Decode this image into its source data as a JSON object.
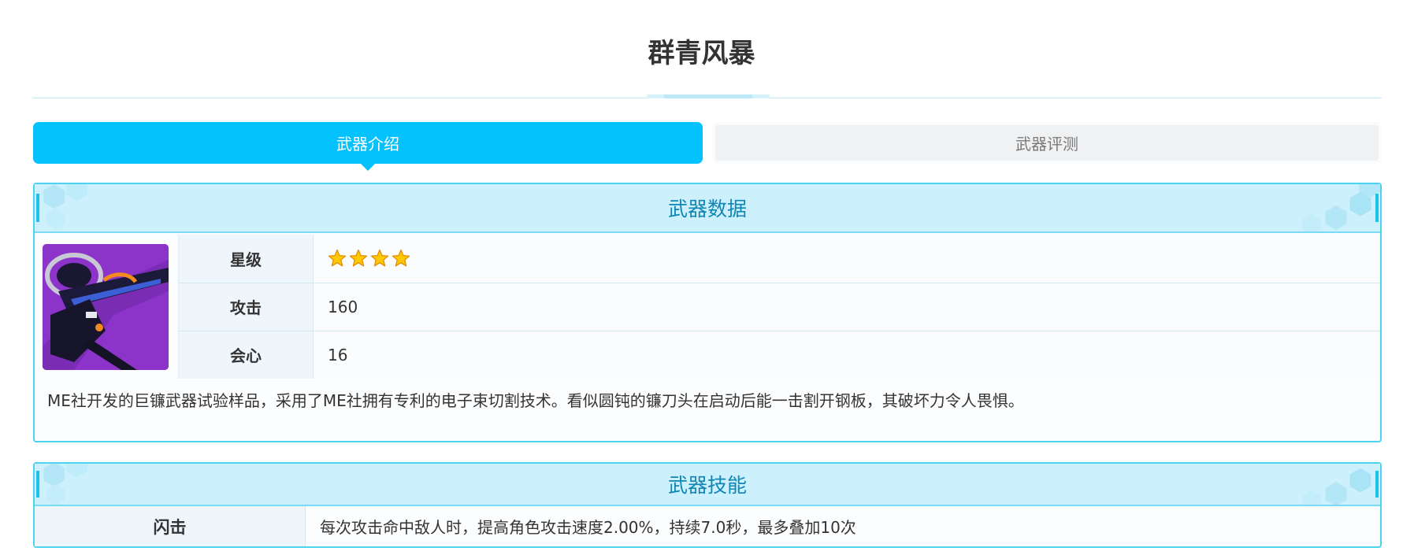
{
  "page": {
    "title": "群青风暴"
  },
  "tabs": [
    {
      "label": "武器介绍",
      "active": true
    },
    {
      "label": "武器评测",
      "active": false
    }
  ],
  "weapon_data": {
    "header": "武器数据",
    "image_icon": "weapon-scythe-image",
    "stats": [
      {
        "label": "星级",
        "value": "",
        "stars": 4
      },
      {
        "label": "攻击",
        "value": "160"
      },
      {
        "label": "会心",
        "value": "16"
      }
    ],
    "description": "ME社开发的巨镰武器试验样品，采用了ME社拥有专利的电子束切割技术。看似圆钝的镰刀头在启动后能一击割开钢板，其破坏力令人畏惧。"
  },
  "weapon_skill": {
    "header": "武器技能",
    "name": "闪击",
    "description": "每次攻击命中敌人时，提高角色攻击速度2.00%，持续7.0秒，最多叠加10次"
  },
  "colors": {
    "accent": "#03c2fd",
    "header_bg": "#cdf1fc",
    "header_text": "#0f86b6",
    "panel_border": "#4cd3f2",
    "star": "#ffc800"
  }
}
